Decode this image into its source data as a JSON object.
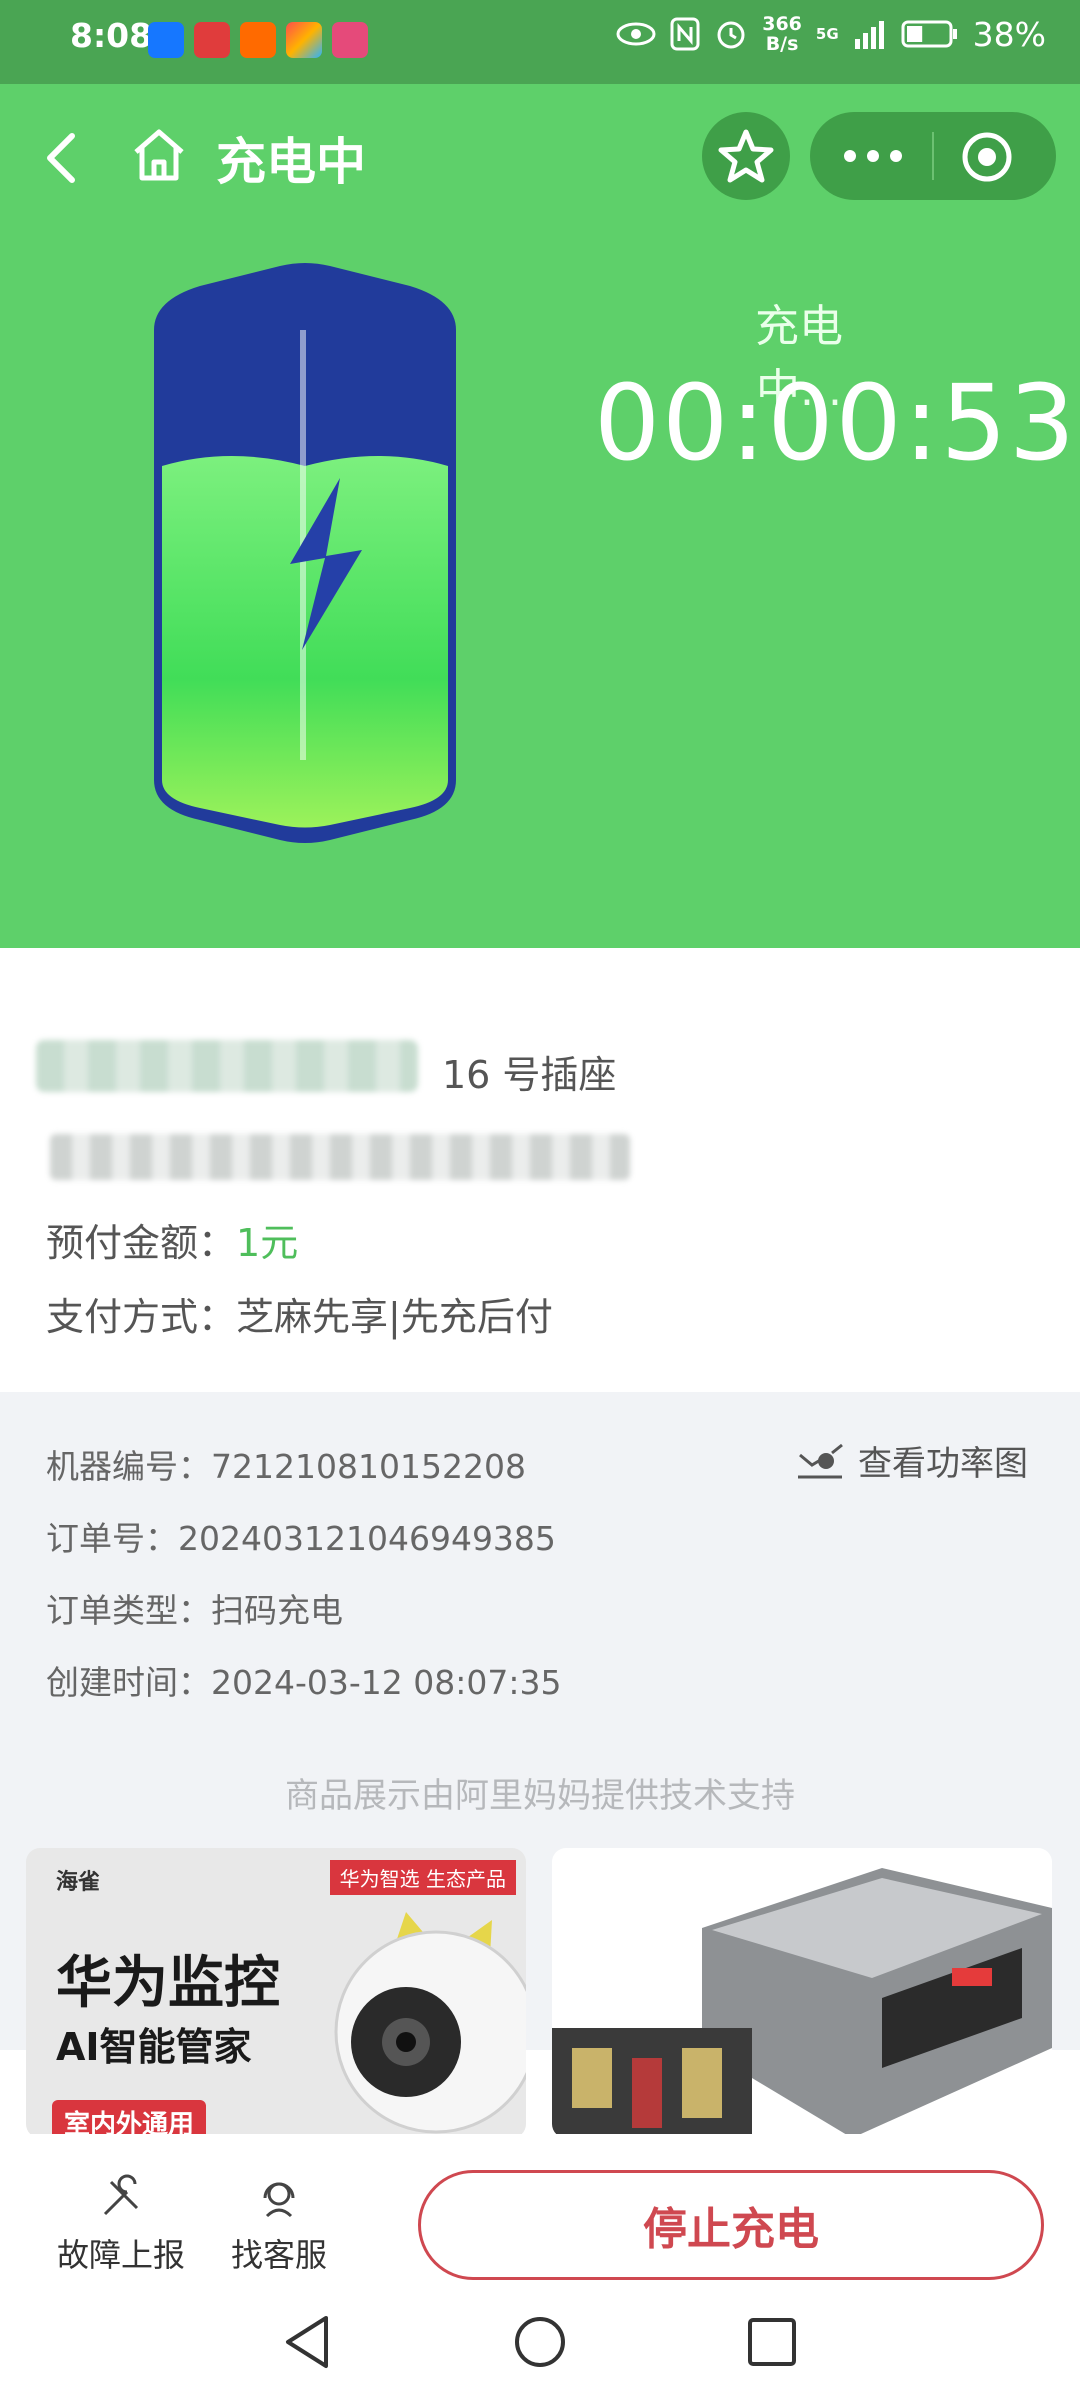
{
  "status_bar": {
    "time": "8:08",
    "net_speed_value": "366",
    "net_speed_unit": "B/s",
    "signal_label": "5G",
    "battery_percent": "38%",
    "battery_level": 0.38
  },
  "header": {
    "title": "充电中"
  },
  "charging": {
    "status_label": "充电中...",
    "elapsed": "00:00:53"
  },
  "order_info": {
    "socket": "16 号插座",
    "prepaid_label": "预付金额：",
    "prepaid_value": "1元",
    "payment_label": "支付方式：",
    "payment_value": "芝麻先享|先充后付"
  },
  "details": {
    "machine_no_label": "机器编号：",
    "machine_no": "721210810152208",
    "order_no_label": "订单号：",
    "order_no": "20240312104694938​5",
    "order_type_label": "订单类型：",
    "order_type": "扫码充电",
    "created_label": "创建时间：",
    "created_time": "2024-03-12 08:07:35",
    "power_chart_link": "查看功率图"
  },
  "ads": {
    "credit": "商品展示由阿里妈妈提供技术支持",
    "card1": {
      "brand": "海雀",
      "tag": "华为智选 生态产品",
      "headline": "华为监控",
      "subline": "AI智能管家",
      "footer": "室内外通用"
    }
  },
  "bottom_bar": {
    "report_label": "故障上报",
    "service_label": "找客服",
    "stop_label": "停止充电"
  },
  "colors": {
    "hero_green": "#5ed06a",
    "status_green": "#4aa553",
    "accent_green": "#4fbe5b",
    "stop_red": "#cf4850",
    "battery_blue": "#1f3f9f"
  }
}
